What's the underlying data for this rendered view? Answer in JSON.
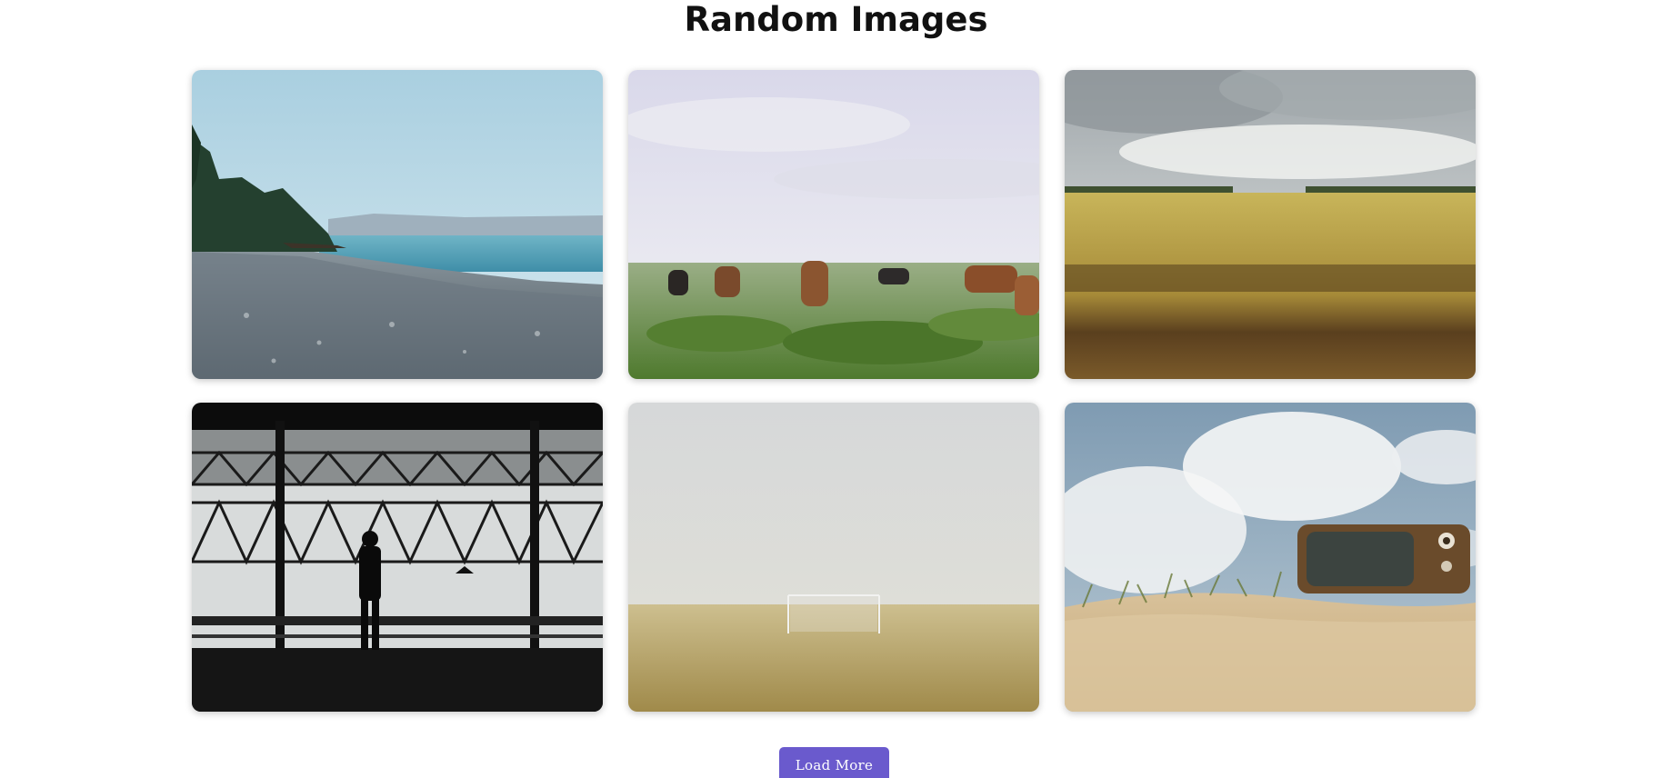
{
  "page": {
    "title": "Random Images"
  },
  "gallery": {
    "images": [
      {
        "subject": "pebble beach with sea and trees"
      },
      {
        "subject": "horses in grass field under cloudy sky"
      },
      {
        "subject": "golden wheat field under clouds"
      },
      {
        "subject": "silhouette of man in front of large window"
      },
      {
        "subject": "foggy field with soccer goal"
      },
      {
        "subject": "old television on sand dune under sky"
      }
    ]
  },
  "actions": {
    "load_more_label": "Load More"
  },
  "colors": {
    "button": "#6a5acd",
    "title": "#111111",
    "background": "#ffffff"
  }
}
